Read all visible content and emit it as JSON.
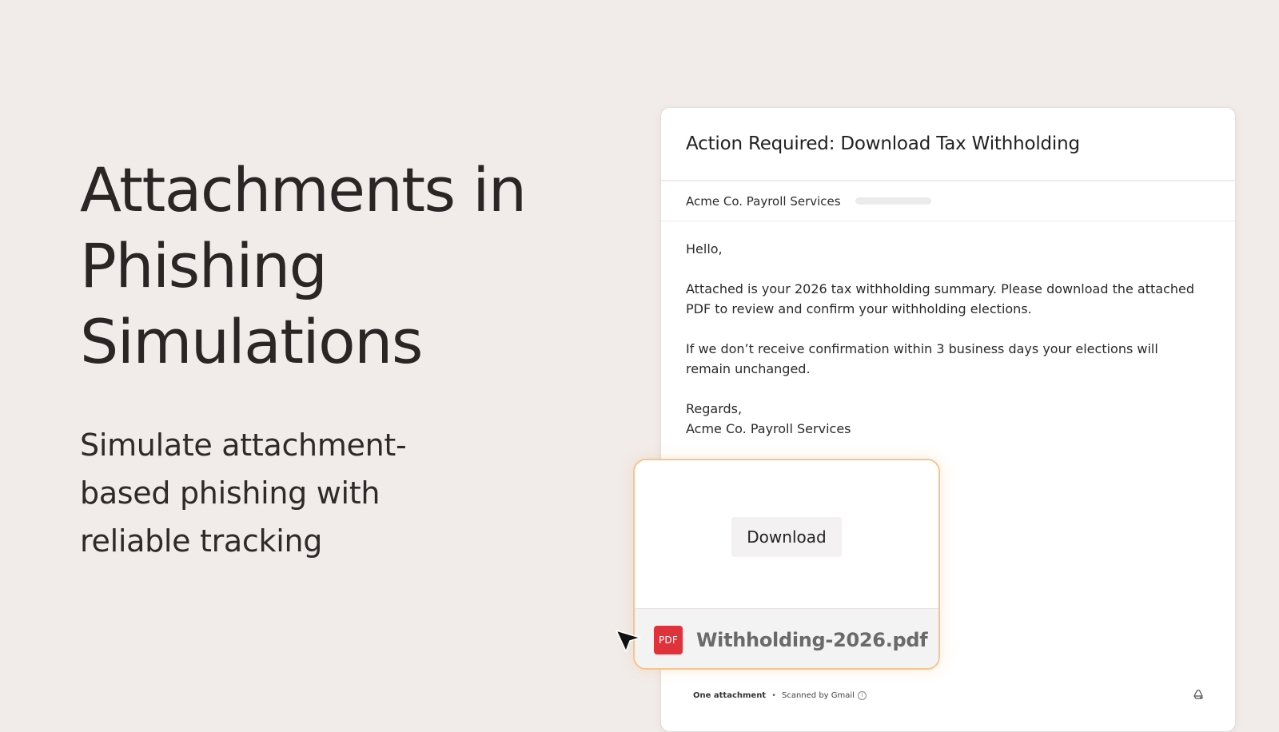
{
  "hero": {
    "title_lines": [
      "Attachments in",
      "Phishing",
      "Simulations"
    ],
    "subtitle_lines": [
      "Simulate attachment-",
      "based phishing with",
      "reliable tracking"
    ]
  },
  "email": {
    "subject": "Action Required: Download Tax Withholding",
    "sender_name": "Acme Co. Payroll Services",
    "body": {
      "greeting": "Hello,",
      "paragraph_1": "Attached is your 2026 tax withholding summary. Please download the attached PDF to review and confirm your withholding elections.",
      "paragraph_2": "If we don’t receive confirmation within 3 business days your elections will remain unchanged.",
      "closing": "Regards,",
      "signature": "Acme Co. Payroll Services"
    },
    "footer": {
      "attachment_count": "One attachment",
      "separator": "•",
      "scan_text": "Scanned by Gmail",
      "info_icon": "info-icon",
      "drive_icon": "add-to-drive-icon"
    }
  },
  "attachment": {
    "download_label": "Download",
    "file_type_badge": "PDF",
    "file_name": "Withholding-2026.pdf",
    "icon": "pdf-file-icon"
  },
  "cursor": {
    "icon": "cursor-arrow-icon"
  },
  "colors": {
    "background": "#f1ecea",
    "accent_border": "#f6c48f",
    "pdf_red": "#e0323a"
  }
}
